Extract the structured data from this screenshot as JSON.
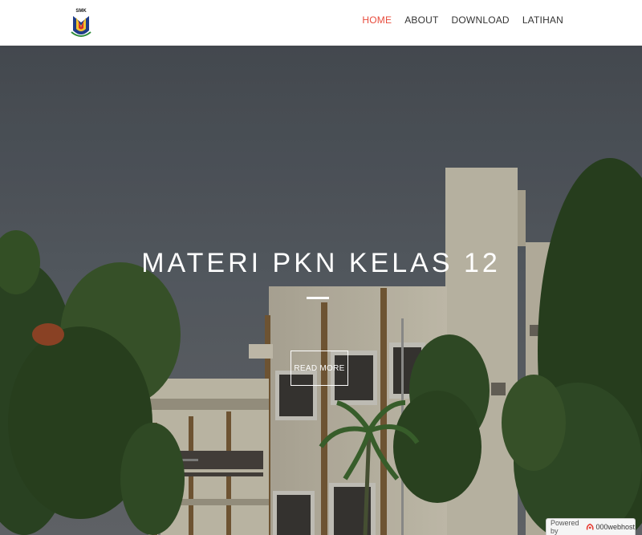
{
  "nav": {
    "items": [
      {
        "label": "HOME",
        "active": true
      },
      {
        "label": "ABOUT",
        "active": false
      },
      {
        "label": "DOWNLOAD",
        "active": false
      },
      {
        "label": "LATIHAN",
        "active": false
      }
    ],
    "active_color": "#e84c3d",
    "text_color": "#333333"
  },
  "logo": {
    "text": "SMK",
    "icon": "school-emblem-icon"
  },
  "hero": {
    "title": "MATERI PKN KELAS 12",
    "button_label": "READ MORE"
  },
  "badge": {
    "powered_label": "Powered by",
    "brand": "000webhost",
    "icon": "webhost-logo-icon"
  }
}
